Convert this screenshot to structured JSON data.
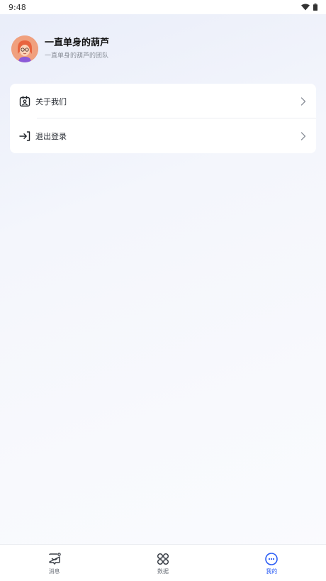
{
  "status_bar": {
    "time": "9:48",
    "wifi_icon": "wifi-icon",
    "battery_icon": "battery-icon"
  },
  "profile": {
    "name": "一直单身的葫芦",
    "subtitle": "一直单身的葫芦的团队",
    "avatar_icon": "avatar-illustration"
  },
  "menu": {
    "items": [
      {
        "label": "关于我们",
        "icon": "about-badge-icon"
      },
      {
        "label": "退出登录",
        "icon": "logout-arrow-icon"
      }
    ]
  },
  "tab_bar": {
    "tabs": [
      {
        "label": "消息",
        "icon": "message-icon",
        "active": false
      },
      {
        "label": "数据",
        "icon": "grid-icon",
        "active": false
      },
      {
        "label": "我的",
        "icon": "smile-icon",
        "active": true
      }
    ]
  },
  "colors": {
    "accent": "#2a5cf5",
    "text_primary": "#111111",
    "text_secondary": "#8a8f99"
  }
}
